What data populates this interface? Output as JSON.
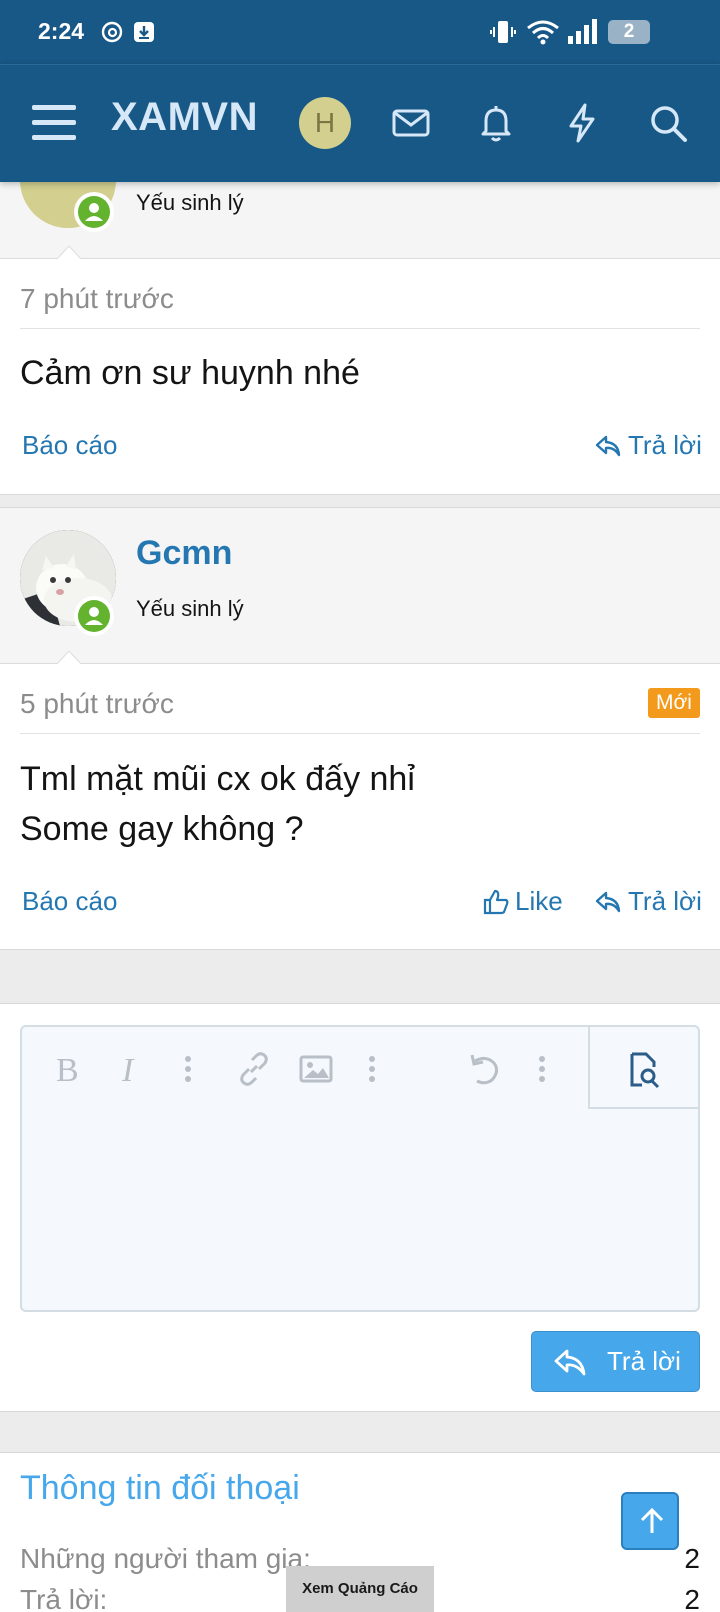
{
  "status_bar": {
    "time": "2:24",
    "battery": "2"
  },
  "header": {
    "brand": "XAMVN",
    "avatar_letter": "H"
  },
  "messages": [
    {
      "username": "",
      "user_title": "Yếu sinh lý",
      "time": "7 phút trước",
      "text_lines": [
        "Cảm ơn sư huynh nhé"
      ],
      "report_label": "Báo cáo",
      "reply_label": "Trả lời"
    },
    {
      "username": "Gcmn",
      "user_title": "Yếu sinh lý",
      "time": "5 phút trước",
      "badge": "Mới",
      "text_lines": [
        "Tml mặt mũi cx ok đấy nhỉ",
        "Some gay không ?"
      ],
      "report_label": "Báo cáo",
      "like_label": "Like",
      "reply_label": "Trả lời"
    }
  ],
  "editor": {
    "toolbar": [
      "bold-icon",
      "italic-icon",
      "more-icon",
      "link-icon",
      "image-icon",
      "more-icon",
      "undo-icon",
      "more-icon",
      "preview-icon"
    ],
    "submit_label": "Trả lời"
  },
  "info": {
    "title": "Thông tin đối thoại",
    "rows": [
      {
        "label": "Những người tham gia:",
        "value": "2"
      },
      {
        "label": "Trả lời:",
        "value": "2"
      }
    ]
  },
  "ad": {
    "label": "Xem Quảng Cáo"
  },
  "colors": {
    "header_bg": "#185886",
    "link": "#2577b1",
    "accent": "#47a7eb",
    "online": "#63b32f",
    "new_badge": "#f39a1c"
  }
}
